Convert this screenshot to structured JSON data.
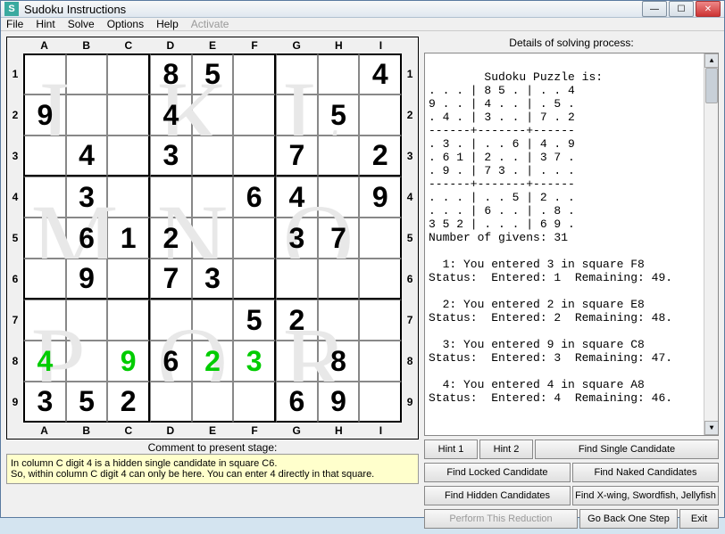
{
  "window": {
    "title": "Sudoku Instructions"
  },
  "menu": {
    "file": "File",
    "hint": "Hint",
    "solve": "Solve",
    "options": "Options",
    "help": "Help",
    "activate": "Activate"
  },
  "cols": [
    "A",
    "B",
    "C",
    "D",
    "E",
    "F",
    "G",
    "H",
    "I"
  ],
  "rows": [
    "1",
    "2",
    "3",
    "4",
    "5",
    "6",
    "7",
    "8",
    "9"
  ],
  "watermarks": [
    "J",
    "K",
    "L",
    "M",
    "N",
    "O",
    "P",
    "Q",
    "R"
  ],
  "grid": [
    [
      {
        "v": "",
        "t": ""
      },
      {
        "v": "",
        "t": ""
      },
      {
        "v": "",
        "t": ""
      },
      {
        "v": "8",
        "t": "g"
      },
      {
        "v": "5",
        "t": "g"
      },
      {
        "v": "",
        "t": ""
      },
      {
        "v": "",
        "t": ""
      },
      {
        "v": "",
        "t": ""
      },
      {
        "v": "4",
        "t": "g"
      }
    ],
    [
      {
        "v": "9",
        "t": "g"
      },
      {
        "v": "",
        "t": ""
      },
      {
        "v": "",
        "t": ""
      },
      {
        "v": "4",
        "t": "g"
      },
      {
        "v": "",
        "t": ""
      },
      {
        "v": "",
        "t": ""
      },
      {
        "v": "",
        "t": ""
      },
      {
        "v": "5",
        "t": "g"
      },
      {
        "v": "",
        "t": ""
      }
    ],
    [
      {
        "v": "",
        "t": ""
      },
      {
        "v": "4",
        "t": "g"
      },
      {
        "v": "",
        "t": ""
      },
      {
        "v": "3",
        "t": "g"
      },
      {
        "v": "",
        "t": ""
      },
      {
        "v": "",
        "t": ""
      },
      {
        "v": "7",
        "t": "g"
      },
      {
        "v": "",
        "t": ""
      },
      {
        "v": "2",
        "t": "g"
      }
    ],
    [
      {
        "v": "",
        "t": ""
      },
      {
        "v": "3",
        "t": "g"
      },
      {
        "v": "",
        "t": ""
      },
      {
        "v": "",
        "t": ""
      },
      {
        "v": "",
        "t": ""
      },
      {
        "v": "6",
        "t": "g"
      },
      {
        "v": "4",
        "t": "g"
      },
      {
        "v": "",
        "t": ""
      },
      {
        "v": "9",
        "t": "g"
      }
    ],
    [
      {
        "v": "",
        "t": ""
      },
      {
        "v": "6",
        "t": "g"
      },
      {
        "v": "1",
        "t": "g"
      },
      {
        "v": "2",
        "t": "g"
      },
      {
        "v": "",
        "t": ""
      },
      {
        "v": "",
        "t": ""
      },
      {
        "v": "3",
        "t": "g"
      },
      {
        "v": "7",
        "t": "g"
      },
      {
        "v": "",
        "t": ""
      }
    ],
    [
      {
        "v": "",
        "t": ""
      },
      {
        "v": "9",
        "t": "g"
      },
      {
        "v": "",
        "t": ""
      },
      {
        "v": "7",
        "t": "g"
      },
      {
        "v": "3",
        "t": "g"
      },
      {
        "v": "",
        "t": ""
      },
      {
        "v": "",
        "t": ""
      },
      {
        "v": "",
        "t": ""
      },
      {
        "v": "",
        "t": ""
      }
    ],
    [
      {
        "v": "",
        "t": ""
      },
      {
        "v": "",
        "t": ""
      },
      {
        "v": "",
        "t": ""
      },
      {
        "v": "",
        "t": ""
      },
      {
        "v": "",
        "t": ""
      },
      {
        "v": "5",
        "t": "g"
      },
      {
        "v": "2",
        "t": "g"
      },
      {
        "v": "",
        "t": ""
      },
      {
        "v": "",
        "t": ""
      }
    ],
    [
      {
        "v": "4",
        "t": "e"
      },
      {
        "v": "",
        "t": ""
      },
      {
        "v": "9",
        "t": "e"
      },
      {
        "v": "6",
        "t": "g"
      },
      {
        "v": "2",
        "t": "e"
      },
      {
        "v": "3",
        "t": "e"
      },
      {
        "v": "",
        "t": ""
      },
      {
        "v": "8",
        "t": "g"
      },
      {
        "v": "",
        "t": ""
      }
    ],
    [
      {
        "v": "3",
        "t": "g"
      },
      {
        "v": "5",
        "t": "g"
      },
      {
        "v": "2",
        "t": "g"
      },
      {
        "v": "",
        "t": ""
      },
      {
        "v": "",
        "t": ""
      },
      {
        "v": "",
        "t": ""
      },
      {
        "v": "6",
        "t": "g"
      },
      {
        "v": "9",
        "t": "g"
      },
      {
        "v": "",
        "t": ""
      }
    ]
  ],
  "comment": {
    "label": "Comment to present stage:",
    "text": "In column C digit 4 is a hidden single candidate in square C6.\nSo, within column C digit 4 can only be here. You can enter 4 directly in that square."
  },
  "details": {
    "label": "Details of solving process:",
    "text": "Sudoku Puzzle is:\n. . . | 8 5 . | . . 4\n9 . . | 4 . . | . 5 .\n. 4 . | 3 . . | 7 . 2\n------+-------+------\n. 3 . | . . 6 | 4 . 9\n. 6 1 | 2 . . | 3 7 .\n. 9 . | 7 3 . | . . .\n------+-------+------\n. . . | . . 5 | 2 . .\n. . . | 6 . . | . 8 .\n3 5 2 | . . . | 6 9 .\nNumber of givens: 31\n\n  1: You entered 3 in square F8\nStatus:  Entered: 1  Remaining: 49.\n\n  2: You entered 2 in square E8\nStatus:  Entered: 2  Remaining: 48.\n\n  3: You entered 9 in square C8\nStatus:  Entered: 3  Remaining: 47.\n\n  4: You entered 4 in square A8\nStatus:  Entered: 4  Remaining: 46."
  },
  "buttons": {
    "hint1": "Hint 1",
    "hint2": "Hint 2",
    "findSingle": "Find Single Candidate",
    "findLocked": "Find Locked Candidate",
    "findNaked": "Find Naked Candidates",
    "findHidden": "Find Hidden Candidates",
    "findXwing": "Find X-wing, Swordfish, Jellyfish",
    "perform": "Perform This Reduction",
    "goBack": "Go Back One Step",
    "exit": "Exit"
  }
}
